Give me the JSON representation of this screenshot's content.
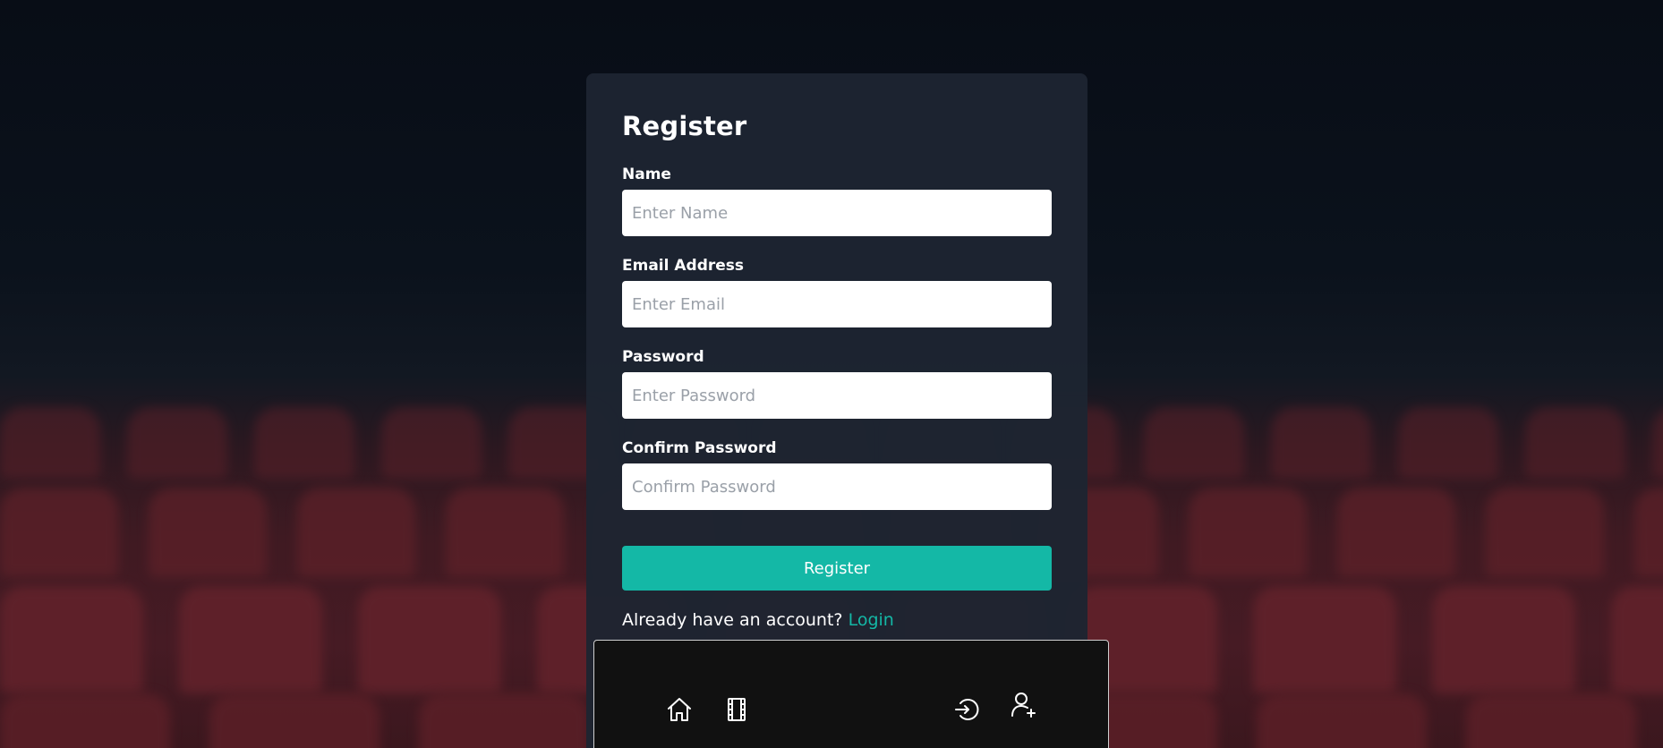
{
  "form": {
    "title": "Register",
    "fields": [
      {
        "label": "Name",
        "placeholder": "Enter Name",
        "value": ""
      },
      {
        "label": "Email Address",
        "placeholder": "Enter Email",
        "value": ""
      },
      {
        "label": "Password",
        "placeholder": "Enter Password",
        "value": ""
      },
      {
        "label": "Confirm Password",
        "placeholder": "Confirm Password",
        "value": ""
      }
    ],
    "submit_label": "Register",
    "login_prompt": "Already have an account?",
    "login_link": "Login"
  },
  "bottom_nav": {
    "items": [
      {
        "icon": "home-icon"
      },
      {
        "icon": "film-icon"
      },
      {
        "icon": "login-icon"
      },
      {
        "icon": "user-add-icon"
      }
    ]
  },
  "colors": {
    "accent": "#14b8a6",
    "card_bg": "#1d2431",
    "nav_bg": "#111111",
    "page_bg_top": "#080d16",
    "seat_red": "#5f2129"
  }
}
